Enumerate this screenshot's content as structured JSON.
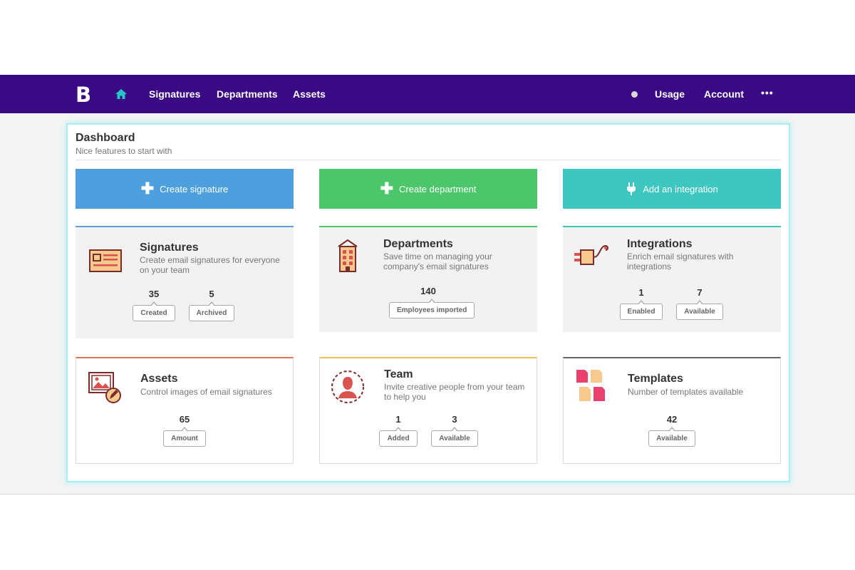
{
  "nav": {
    "logo": "B",
    "links": [
      "Signatures",
      "Departments",
      "Assets"
    ],
    "right": [
      "Usage",
      "Account"
    ],
    "more": "•••"
  },
  "dashboard": {
    "title": "Dashboard",
    "subtitle": "Nice features to start with"
  },
  "actions": [
    {
      "label": "Create signature",
      "color": "#4d9fdd",
      "icon": "plus-icon"
    },
    {
      "label": "Create department",
      "color": "#4cc66a",
      "icon": "plus-icon"
    },
    {
      "label": "Add an integration",
      "color": "#3ec7c1",
      "icon": "plug-icon"
    }
  ],
  "cards": {
    "signatures": {
      "title": "Signatures",
      "desc": "Create email signatures for everyone on your team",
      "stats": [
        {
          "value": "35",
          "label": "Created"
        },
        {
          "value": "5",
          "label": "Archived"
        }
      ],
      "accent": "#5aa0dc",
      "icon": "signature-card-icon"
    },
    "departments": {
      "title": "Departments",
      "desc": "Save time on managing your company's email signatures",
      "stats": [
        {
          "value": "140",
          "label": "Employees imported"
        }
      ],
      "accent": "#4cc66a",
      "icon": "building-icon"
    },
    "integrations": {
      "title": "Integrations",
      "desc": "Enrich email signatures with integrations",
      "stats": [
        {
          "value": "1",
          "label": "Enabled"
        },
        {
          "value": "7",
          "label": "Available"
        }
      ],
      "accent": "#3ec7c1",
      "icon": "plug-cable-icon"
    },
    "assets": {
      "title": "Assets",
      "desc": "Control images of email signatures",
      "stats": [
        {
          "value": "65",
          "label": "Amount"
        }
      ],
      "accent": "#e0765a",
      "icon": "image-edit-icon"
    },
    "team": {
      "title": "Team",
      "desc": "Invite creative people from your team to help you",
      "stats": [
        {
          "value": "1",
          "label": "Added"
        },
        {
          "value": "3",
          "label": "Available"
        }
      ],
      "accent": "#f2c14e",
      "icon": "person-icon"
    },
    "templates": {
      "title": "Templates",
      "desc": "Number of templates available",
      "stats": [
        {
          "value": "42",
          "label": "Available"
        }
      ],
      "accent": "#666666",
      "icon": "templates-icon"
    }
  }
}
